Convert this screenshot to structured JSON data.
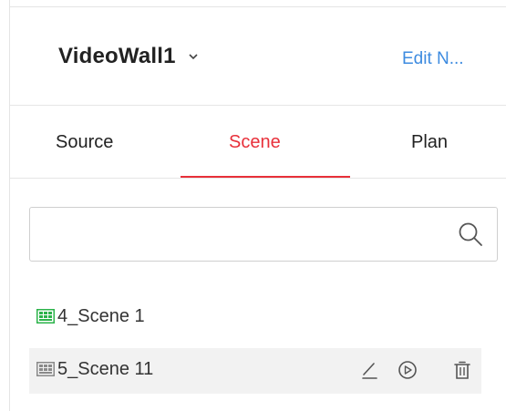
{
  "header": {
    "wall_name": "VideoWall1",
    "edit_label": "Edit N..."
  },
  "tabs": [
    {
      "label": "Source",
      "active": false
    },
    {
      "label": "Scene",
      "active": true
    },
    {
      "label": "Plan",
      "active": false
    }
  ],
  "search": {
    "value": "",
    "placeholder": ""
  },
  "scenes": [
    {
      "label": "4_Scene 1",
      "status": "active",
      "icon": "grid-icon"
    },
    {
      "label": "5_Scene 11",
      "status": "inactive",
      "icon": "grid-icon",
      "hovered": true
    }
  ],
  "colors": {
    "accent": "#e8303a",
    "link": "#3d8be0",
    "active_scene_icon": "#2bb34a",
    "inactive_scene_icon": "#8a8a8a",
    "hover_row": "#f2f2f2"
  },
  "row_actions": [
    "edit-icon",
    "play-icon",
    "delete-icon"
  ]
}
